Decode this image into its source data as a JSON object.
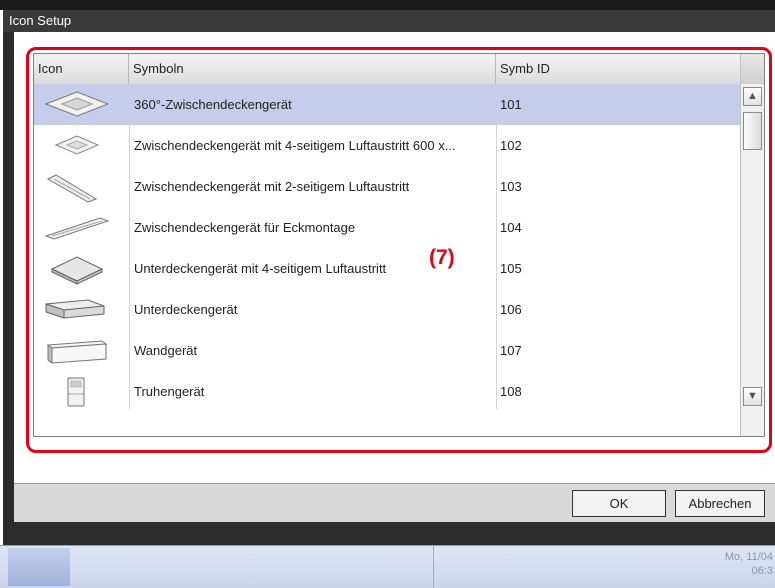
{
  "dialog": {
    "title": "Icon Setup",
    "annotation": "(7)"
  },
  "table": {
    "headers": {
      "icon": "Icon",
      "name": "Symboln",
      "id": "Symb ID"
    },
    "rows": [
      {
        "icon": "ceiling-cassette-360-icon",
        "name": "360°-Zwischendeckengerät",
        "id": "101",
        "selected": true
      },
      {
        "icon": "ceiling-cassette-4way-icon",
        "name": "Zwischendeckengerät mit 4-seitigem Luftaustritt  600 x...",
        "id": "102",
        "selected": false
      },
      {
        "icon": "ceiling-cassette-2way-icon",
        "name": "Zwischendeckengerät mit 2-seitigem Luftaustritt",
        "id": "103",
        "selected": false
      },
      {
        "icon": "ceiling-corner-icon",
        "name": "Zwischendeckengerät für Eckmontage",
        "id": "104",
        "selected": false
      },
      {
        "icon": "underceiling-4way-icon",
        "name": "Unterdeckengerät mit 4-seitigem Luftaustritt",
        "id": "105",
        "selected": false
      },
      {
        "icon": "underceiling-icon",
        "name": "Unterdeckengerät",
        "id": "106",
        "selected": false
      },
      {
        "icon": "wall-unit-icon",
        "name": "Wandgerät",
        "id": "107",
        "selected": false
      },
      {
        "icon": "floor-unit-icon",
        "name": "Truhengerät",
        "id": "108",
        "selected": false
      }
    ]
  },
  "buttons": {
    "ok": "OK",
    "cancel": "Abbrechen"
  },
  "taskbar": {
    "clock_line1": "Mo, 11/04",
    "clock_line2": "06:3"
  }
}
